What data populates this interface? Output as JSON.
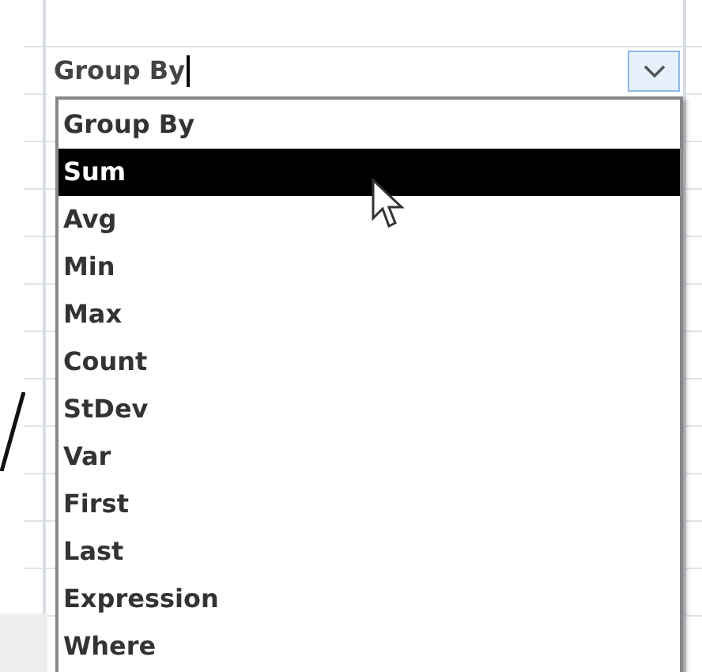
{
  "total_field": {
    "value": "Group By"
  },
  "options": [
    {
      "label": "Group By",
      "selected": false
    },
    {
      "label": "Sum",
      "selected": true
    },
    {
      "label": "Avg",
      "selected": false
    },
    {
      "label": "Min",
      "selected": false
    },
    {
      "label": "Max",
      "selected": false
    },
    {
      "label": "Count",
      "selected": false
    },
    {
      "label": "StDev",
      "selected": false
    },
    {
      "label": "Var",
      "selected": false
    },
    {
      "label": "First",
      "selected": false
    },
    {
      "label": "Last",
      "selected": false
    },
    {
      "label": "Expression",
      "selected": false
    },
    {
      "label": "Where",
      "selected": false
    }
  ]
}
